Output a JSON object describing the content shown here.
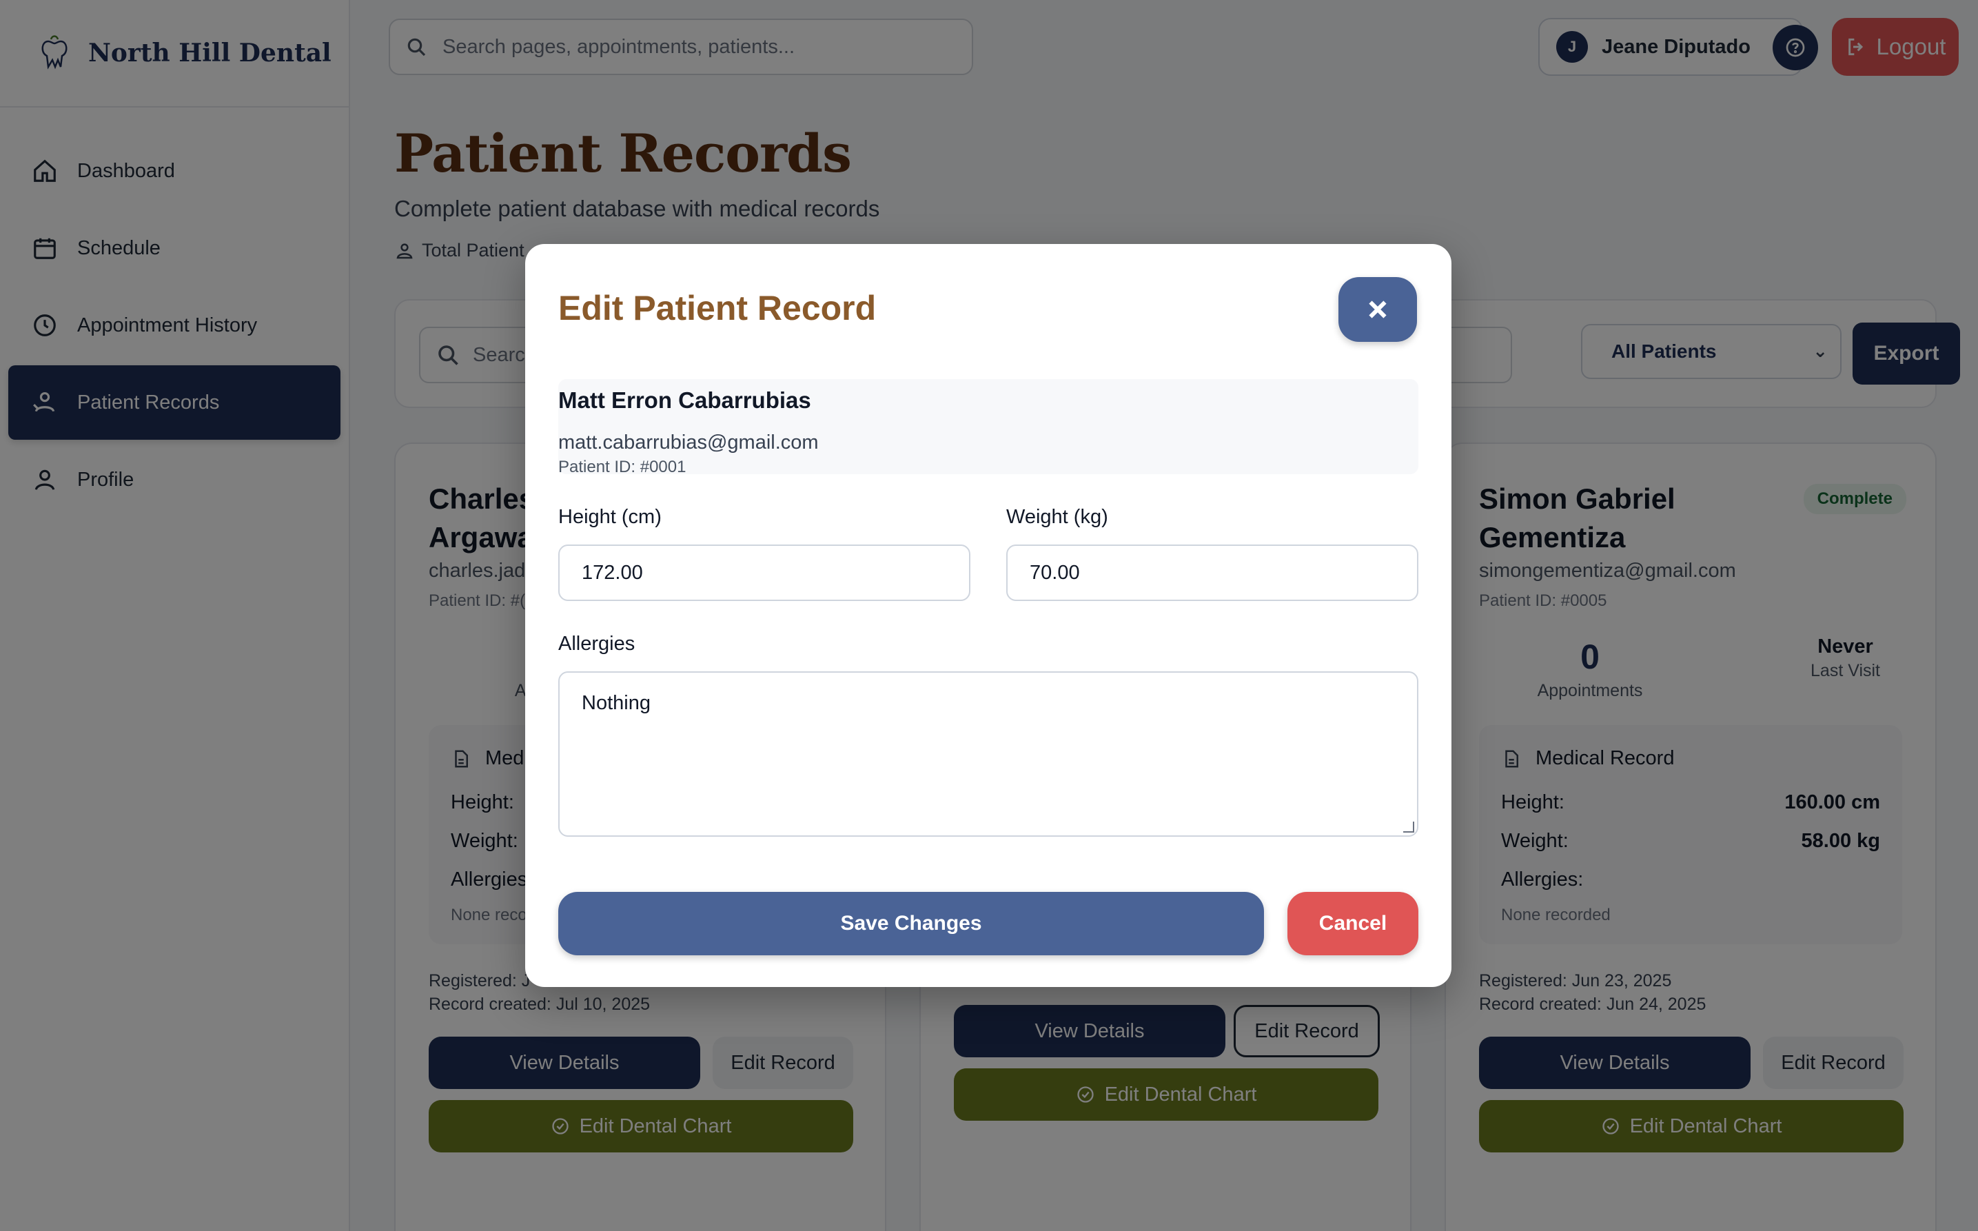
{
  "brand": {
    "name": "North Hill Dental"
  },
  "sidebar": {
    "items": [
      {
        "label": "Dashboard",
        "icon": "home-icon"
      },
      {
        "label": "Schedule",
        "icon": "calendar-icon"
      },
      {
        "label": "Appointment History",
        "icon": "clock-icon"
      },
      {
        "label": "Patient Records",
        "icon": "patient-icon",
        "active": true
      },
      {
        "label": "Profile",
        "icon": "user-icon"
      }
    ]
  },
  "topbar": {
    "search_placeholder": "Search pages, appointments, patients...",
    "user_initial": "J",
    "user_name": "Jeane Diputado",
    "logout_label": "Logout"
  },
  "page": {
    "title": "Patient Records",
    "subtitle": "Complete patient database with medical records",
    "total_label": "Total Patient"
  },
  "filters": {
    "search_placeholder": "Searc",
    "select_value": "All Patients",
    "export_label": "Export"
  },
  "cards": [
    {
      "name_line1": "Charles",
      "name_line2": "Argawa",
      "email": "charles.jad",
      "patient_id": "Patient ID: #(",
      "appointments_num": "(",
      "appointments_label": "Appoir",
      "medical_header": "Medi",
      "height_label": "Height:",
      "weight_label": "Weight:",
      "allergies_label": "Allergies",
      "none_recorded": "None reco",
      "registered": "Registered: J",
      "record_created": "Record created: Jul 10, 2025",
      "view_label": "View Details",
      "edit_label": "Edit Record",
      "chart_label": "Edit Dental Chart"
    },
    {
      "view_label": "View Details",
      "edit_label": "Edit Record",
      "chart_label": "Edit Dental Chart"
    },
    {
      "name_line1": "Simon Gabriel",
      "name_line2": "Gementiza",
      "status": "Complete",
      "email": "simongementiza@gmail.com",
      "patient_id": "Patient ID: #0005",
      "appointments_num": "0",
      "appointments_label": "Appointments",
      "last_visit_value": "Never",
      "last_visit_label": "Last Visit",
      "medical_header": "Medical Record",
      "height_label": "Height:",
      "height_value": "160.00 cm",
      "weight_label": "Weight:",
      "weight_value": "58.00 kg",
      "allergies_label": "Allergies:",
      "none_recorded": "None recorded",
      "registered": "Registered: Jun 23, 2025",
      "record_created": "Record created: Jun 24, 2025",
      "view_label": "View Details",
      "edit_label": "Edit Record",
      "chart_label": "Edit Dental Chart"
    }
  ],
  "modal": {
    "title": "Edit Patient Record",
    "patient_name": "Matt Erron Cabarrubias",
    "patient_email": "matt.cabarrubias@gmail.com",
    "patient_id": "Patient ID: #0001",
    "height_label": "Height (cm)",
    "height_value": "172.00",
    "weight_label": "Weight (kg)",
    "weight_value": "70.00",
    "allergies_label": "Allergies",
    "allergies_value": "Nothing",
    "save_label": "Save Changes",
    "cancel_label": "Cancel"
  },
  "colors": {
    "navy": "#1e2f57",
    "title_brown": "#5b2f12",
    "modal_title": "#8a5a2b",
    "save_blue": "#4a6396",
    "cancel_red": "#e05555",
    "chart_olive": "#6b7a1f"
  }
}
